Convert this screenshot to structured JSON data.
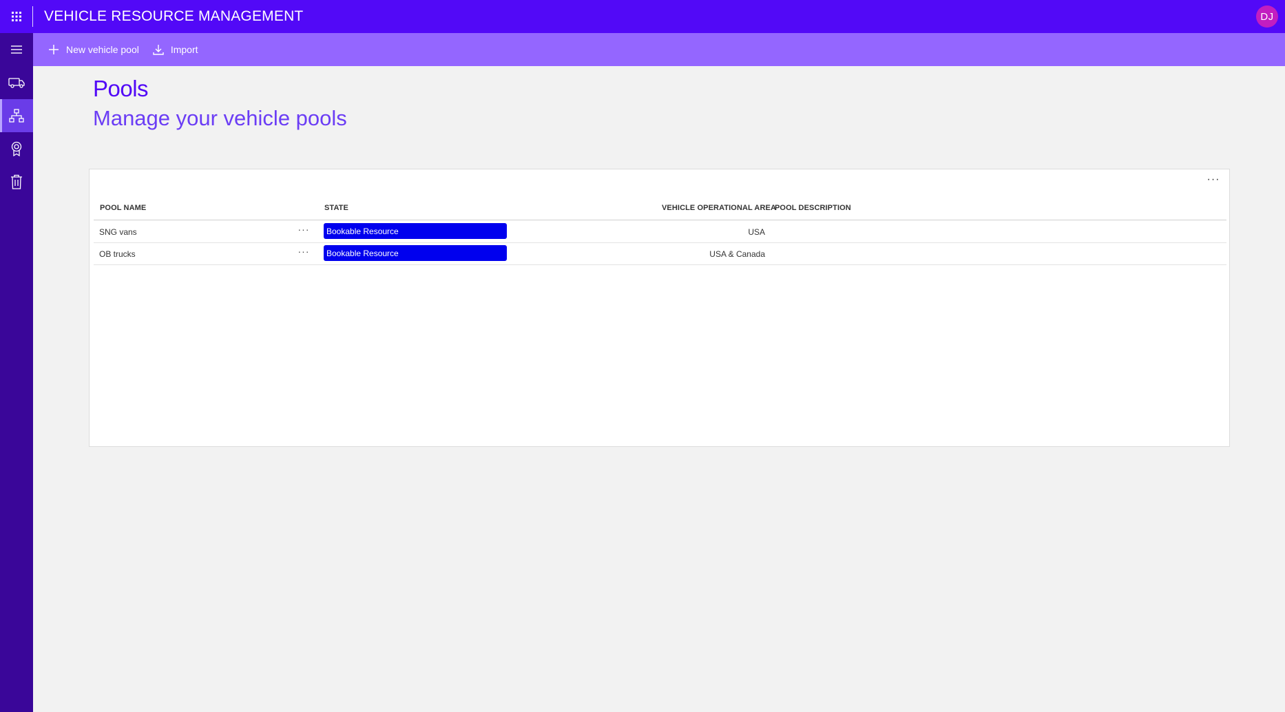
{
  "app": {
    "title": "VEHICLE RESOURCE MANAGEMENT",
    "user_initials": "DJ",
    "brand_color": "#5209f7"
  },
  "commandbar": {
    "new_label": "New vehicle pool",
    "import_label": "Import"
  },
  "rail": {
    "items": [
      "menu-icon",
      "vehicle-icon",
      "org-chart-icon",
      "award-icon",
      "trash-icon"
    ],
    "active": "org-chart-icon"
  },
  "page": {
    "title": "Pools",
    "subtitle": "Manage your vehicle pools"
  },
  "grid": {
    "columns": {
      "pool_name": "POOL NAME",
      "state": "STATE",
      "area": "VEHICLE OPERATIONAL AREA",
      "description": "POOL DESCRIPTION"
    },
    "more_label": "···",
    "rows": [
      {
        "pool_name": "SNG vans",
        "state": "Bookable Resource",
        "area": "USA",
        "description": ""
      },
      {
        "pool_name": "OB trucks",
        "state": "Bookable Resource",
        "area": "USA & Canada",
        "description": ""
      }
    ],
    "state_color": "#0000ee"
  }
}
